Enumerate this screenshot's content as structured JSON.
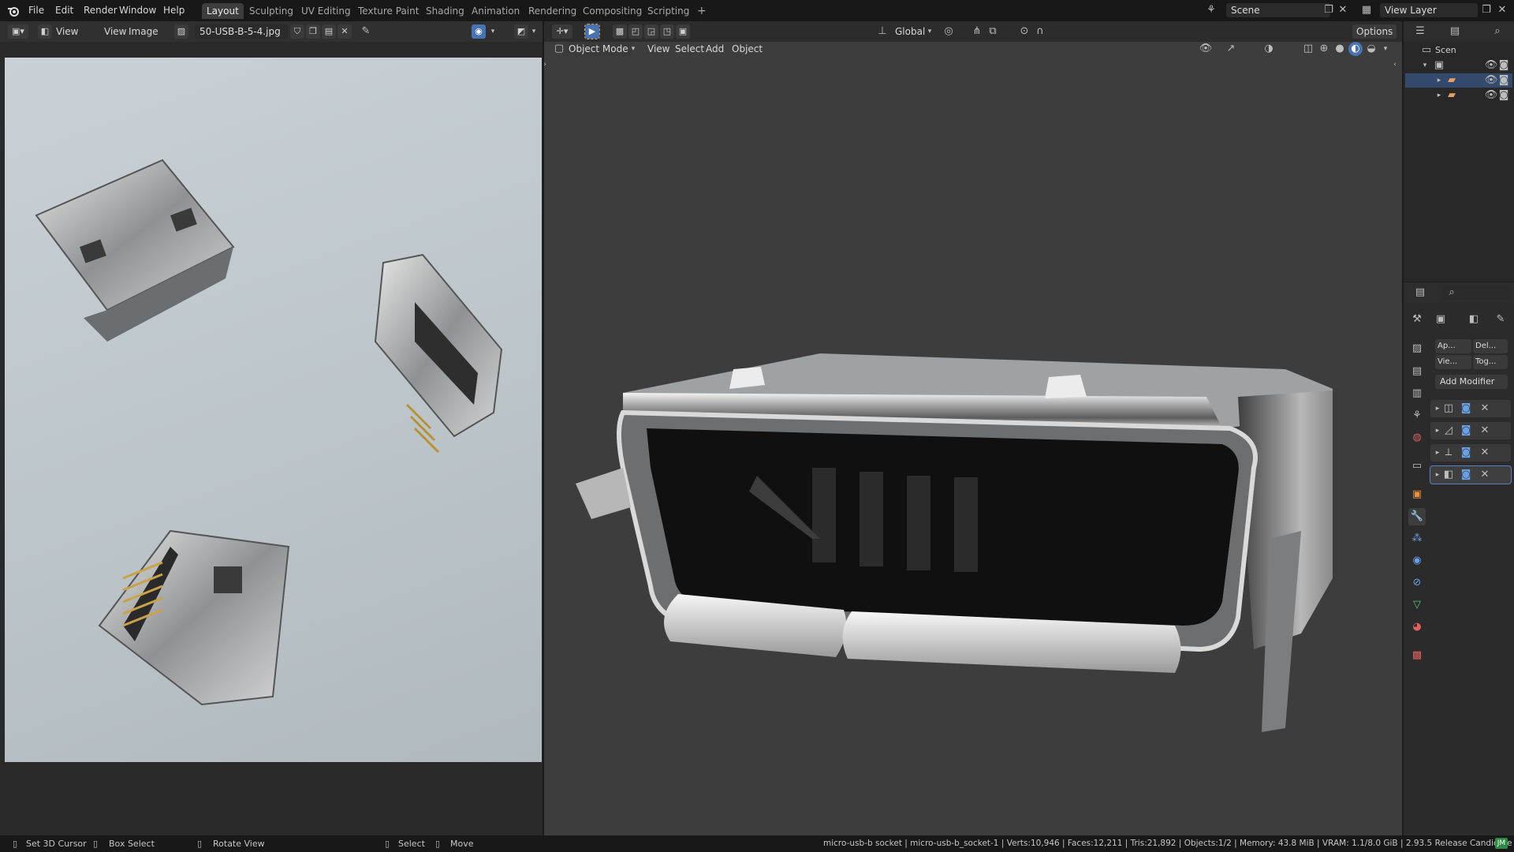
{
  "topbar": {
    "menus": [
      "File",
      "Edit",
      "Render",
      "Window",
      "Help"
    ],
    "workspaces": [
      "Layout",
      "Sculpting",
      "UV Editing",
      "Texture Paint",
      "Shading",
      "Animation",
      "Rendering",
      "Compositing",
      "Scripting"
    ],
    "active_workspace": "Layout",
    "add_workspace": "+",
    "scene_name": "Scene",
    "view_layer_name": "View Layer"
  },
  "image_editor": {
    "view_label": "View",
    "menu_view": "View",
    "menu_image": "Image",
    "image_name": "50-USB-B-5-4.jpg"
  },
  "viewport": {
    "mode": "Object Mode",
    "menus": [
      "View",
      "Select",
      "Add",
      "Object"
    ],
    "transform_orientation": "Global",
    "options": "Options"
  },
  "outliner": {
    "scene_label": "Scen"
  },
  "properties": {
    "apply": "Ap...",
    "delete": "Del...",
    "viewport": "Vie...",
    "toggle": "Tog...",
    "add_modifier": "Add Modifier",
    "modifier_count": 4
  },
  "statusbar": {
    "set_cursor": "Set 3D Cursor",
    "box_select": "Box Select",
    "rotate_view": "Rotate View",
    "select": "Select",
    "move": "Move",
    "info": "micro-usb-b socket | micro-usb-b_socket-1 | Verts:10,946 | Faces:12,211 | Tris:21,892 | Objects:1/2 | Memory: 43.8 MiB | VRAM: 1.1/8.0 GiB | 2.93.5 Release Candidate"
  },
  "colors": {
    "accent": "#4772b3",
    "active_tab": "#3d3d3d"
  }
}
